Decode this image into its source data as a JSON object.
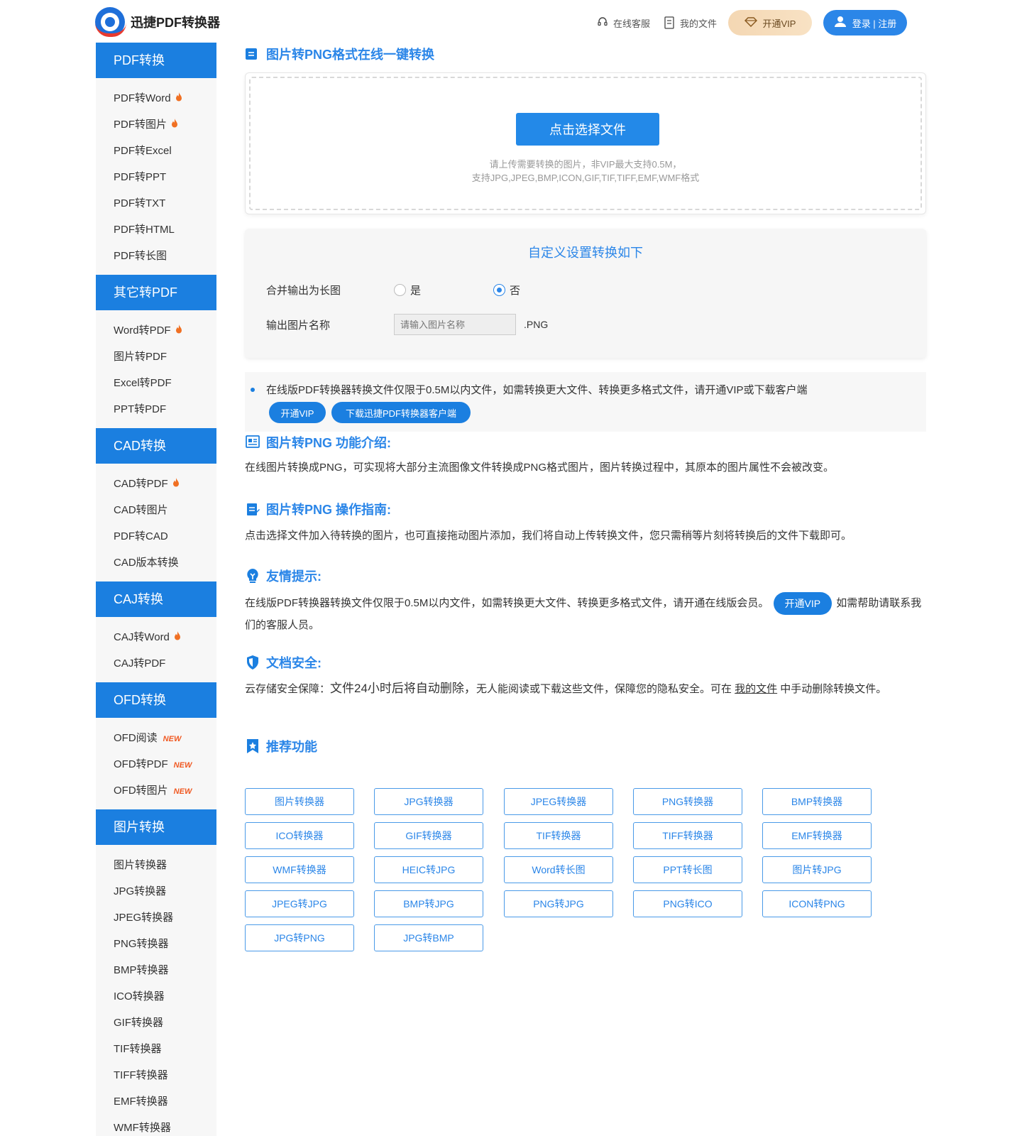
{
  "header": {
    "logo_text": "迅捷PDF转换器",
    "service_label": "在线客服",
    "files_label": "我的文件",
    "vip_label": "开通VIP",
    "login_label": "登录 | 注册"
  },
  "sidebar": {
    "categories": [
      {
        "title": "PDF转换",
        "items": [
          {
            "label": "PDF转Word",
            "badge": "fire"
          },
          {
            "label": "PDF转图片",
            "badge": "fire"
          },
          {
            "label": "PDF转Excel"
          },
          {
            "label": "PDF转PPT"
          },
          {
            "label": "PDF转TXT"
          },
          {
            "label": "PDF转HTML"
          },
          {
            "label": "PDF转长图"
          }
        ]
      },
      {
        "title": "其它转PDF",
        "items": [
          {
            "label": "Word转PDF",
            "badge": "fire"
          },
          {
            "label": "图片转PDF"
          },
          {
            "label": "Excel转PDF"
          },
          {
            "label": "PPT转PDF"
          }
        ]
      },
      {
        "title": "CAD转换",
        "items": [
          {
            "label": "CAD转PDF",
            "badge": "fire"
          },
          {
            "label": "CAD转图片"
          },
          {
            "label": "PDF转CAD"
          },
          {
            "label": "CAD版本转换"
          }
        ]
      },
      {
        "title": "CAJ转换",
        "items": [
          {
            "label": "CAJ转Word",
            "badge": "fire"
          },
          {
            "label": "CAJ转PDF"
          }
        ]
      },
      {
        "title": "OFD转换",
        "items": [
          {
            "label": "OFD阅读",
            "badge": "new"
          },
          {
            "label": "OFD转PDF",
            "badge": "new"
          },
          {
            "label": "OFD转图片",
            "badge": "new"
          }
        ]
      },
      {
        "title": "图片转换",
        "items": [
          {
            "label": "图片转换器"
          },
          {
            "label": "JPG转换器"
          },
          {
            "label": "JPEG转换器"
          },
          {
            "label": "PNG转换器"
          },
          {
            "label": "BMP转换器"
          },
          {
            "label": "ICO转换器"
          },
          {
            "label": "GIF转换器"
          },
          {
            "label": "TIF转换器"
          },
          {
            "label": "TIFF转换器"
          },
          {
            "label": "EMF转换器"
          },
          {
            "label": "WMF转换器"
          }
        ]
      }
    ],
    "new_badge_text": "NEW"
  },
  "main": {
    "title": "图片转PNG格式在线一键转换",
    "upload": {
      "button_label": "点击选择文件",
      "tip_line1": "请上传需要转换的图片，非VIP最大支持0.5M，",
      "tip_line2": "支持JPG,JPEG,BMP,ICON,GIF,TIF,TIFF,EMF,WMF格式"
    },
    "settings": {
      "title": "自定义设置转换如下",
      "merge_label": "合并输出为长图",
      "option_yes": "是",
      "option_no": "否",
      "selected": "否",
      "name_label": "输出图片名称",
      "name_placeholder": "请输入图片名称",
      "extension": ".PNG"
    },
    "notice": {
      "text": "在线版PDF转换器转换文件仅限于0.5M以内文件，如需转换更大文件、转换更多格式文件，请开通VIP或下载客户端",
      "vip_button": "开通VIP",
      "download_button": "下载迅捷PDF转换器客户端"
    },
    "intro": {
      "title": "图片转PNG 功能介绍:",
      "body": "在线图片转换成PNG，可实现将大部分主流图像文件转换成PNG格式图片，图片转换过程中，其原本的图片属性不会被改变。"
    },
    "guide": {
      "title": "图片转PNG 操作指南:",
      "body": "点击选择文件加入待转换的图片，也可直接拖动图片添加，我们将自动上传转换文件，您只需稍等片刻将转换后的文件下载即可。"
    },
    "tips": {
      "title": "友情提示:",
      "body_before": "在线版PDF转换器转换文件仅限于0.5M以内文件，如需转换更大文件、转换更多格式文件，请开通在线版会员。",
      "vip_button": "开通VIP",
      "body_after": "如需帮助请联系我们的客服人员。"
    },
    "security": {
      "title": "文档安全:",
      "prefix": "云存储安全保障：",
      "highlight": "文件24小时后将自动删除，",
      "middle": "无人能阅读或下载这些文件，保障您的隐私安全。可在 ",
      "link": "我的文件",
      "suffix": " 中手动删除转换文件。"
    },
    "recommend": {
      "title": "推荐功能",
      "items": [
        "图片转换器",
        "JPG转换器",
        "JPEG转换器",
        "PNG转换器",
        "BMP转换器",
        "ICO转换器",
        "GIF转换器",
        "TIF转换器",
        "TIFF转换器",
        "EMF转换器",
        "WMF转换器",
        "HEIC转JPG",
        "Word转长图",
        "PPT转长图",
        "图片转JPG",
        "JPEG转JPG",
        "BMP转JPG",
        "PNG转JPG",
        "PNG转ICO",
        "ICON转PNG",
        "JPG转PNG",
        "JPG转BMP"
      ]
    }
  },
  "colors": {
    "accent": "#1b7fe0",
    "link_blue": "#2b86e8",
    "fire": "#f07023",
    "vip_gold": "#f4d7b3"
  }
}
